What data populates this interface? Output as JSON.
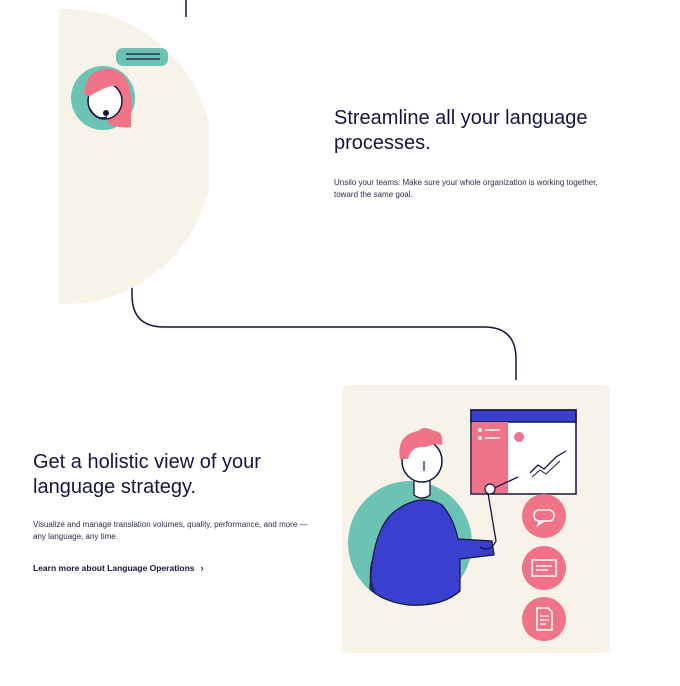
{
  "section1": {
    "title": "Streamline all your language processes.",
    "description": "Unsilo your teams: Make sure your whole organization is working together, toward the same goal."
  },
  "section2": {
    "title": "Get a holistic view of your language strategy.",
    "description": "Visualize and manage translation volumes, quality, performance, and more — any language, any time.",
    "link_label": "Learn more about Language Operations",
    "link_icon": "chevron-right-icon"
  },
  "colors": {
    "navy": "#14163f",
    "cream": "#f7f3e9",
    "teal": "#6cc3b4",
    "pink": "#f07388",
    "blue": "#3a3fce"
  }
}
